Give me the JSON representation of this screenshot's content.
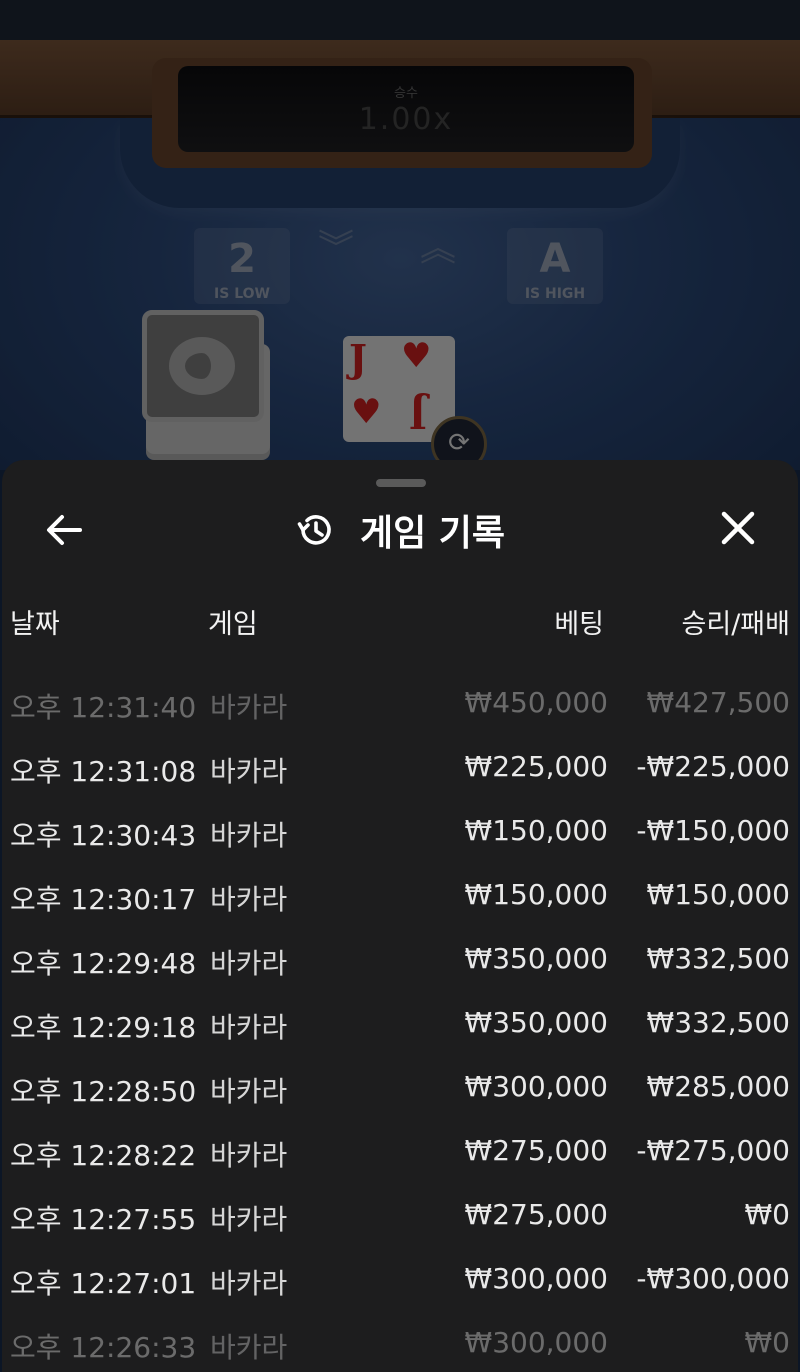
{
  "game": {
    "multiplier_label": "승수",
    "multiplier_value": "1.00x",
    "low_rank": "2",
    "low_text": "IS LOW",
    "high_rank": "A",
    "high_text": "IS HIGH",
    "current_card": {
      "rank": "J",
      "suit": "♥"
    },
    "icons": [
      "chevrons-down-icon",
      "chevrons-up-icon",
      "swap-card-icon"
    ]
  },
  "history_sheet": {
    "title": "게임 기록",
    "icons": {
      "back": "arrow-left-icon",
      "history": "history-clock-icon",
      "close": "close-icon"
    },
    "columns": {
      "date": "날짜",
      "game": "게임",
      "bet": "베팅",
      "result": "승리/패배"
    },
    "rows": [
      {
        "time": "오후 12:31:40",
        "game": "바카라",
        "bet": "₩450,000",
        "result": "₩427,500"
      },
      {
        "time": "오후 12:31:08",
        "game": "바카라",
        "bet": "₩225,000",
        "result": "-₩225,000"
      },
      {
        "time": "오후 12:30:43",
        "game": "바카라",
        "bet": "₩150,000",
        "result": "-₩150,000"
      },
      {
        "time": "오후 12:30:17",
        "game": "바카라",
        "bet": "₩150,000",
        "result": "₩150,000"
      },
      {
        "time": "오후 12:29:48",
        "game": "바카라",
        "bet": "₩350,000",
        "result": "₩332,500"
      },
      {
        "time": "오후 12:29:18",
        "game": "바카라",
        "bet": "₩350,000",
        "result": "₩332,500"
      },
      {
        "time": "오후 12:28:50",
        "game": "바카라",
        "bet": "₩300,000",
        "result": "₩285,000"
      },
      {
        "time": "오후 12:28:22",
        "game": "바카라",
        "bet": "₩275,000",
        "result": "-₩275,000"
      },
      {
        "time": "오후 12:27:55",
        "game": "바카라",
        "bet": "₩275,000",
        "result": "₩0"
      },
      {
        "time": "오후 12:27:01",
        "game": "바카라",
        "bet": "₩300,000",
        "result": "-₩300,000"
      },
      {
        "time": "오후 12:26:33",
        "game": "바카라",
        "bet": "₩300,000",
        "result": "₩0"
      }
    ]
  }
}
